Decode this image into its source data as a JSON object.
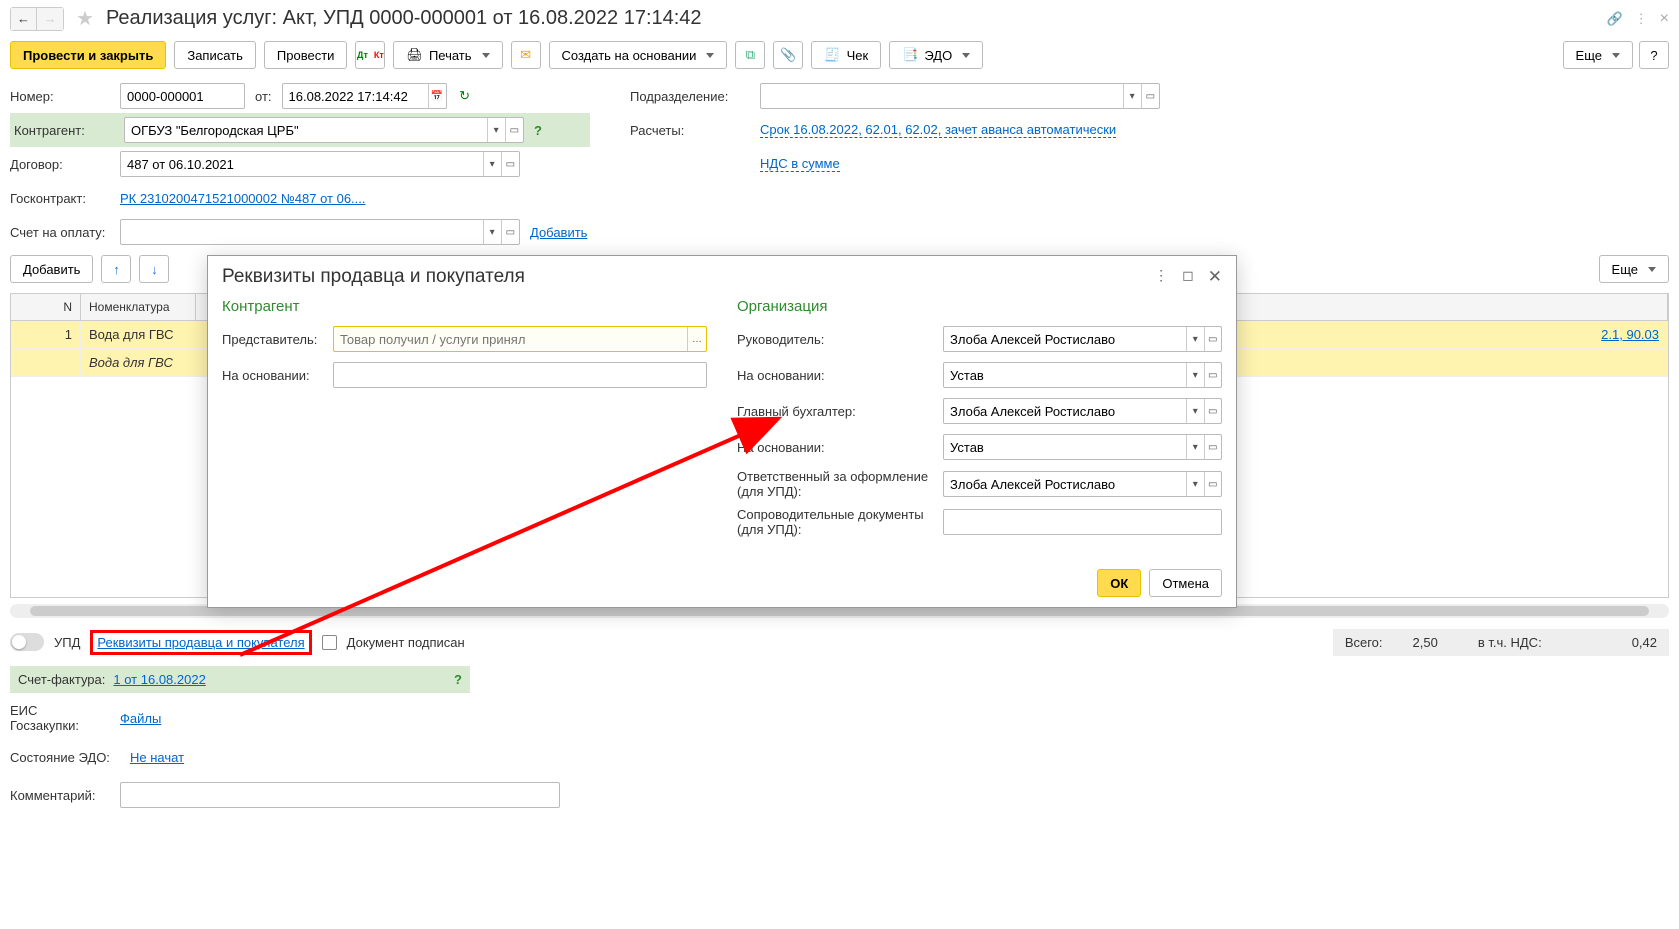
{
  "header": {
    "title": "Реализация услуг: Акт, УПД 0000-000001 от 16.08.2022 17:14:42"
  },
  "toolbar": {
    "post_close": "Провести и закрыть",
    "save": "Записать",
    "post": "Провести",
    "print": "Печать",
    "create_based": "Создать на основании",
    "check": "Чек",
    "edo": "ЭДО",
    "more": "Еще"
  },
  "form": {
    "number_label": "Номер:",
    "number": "0000-000001",
    "date_label": "от:",
    "date": "16.08.2022 17:14:42",
    "division_label": "Подразделение:",
    "counterparty_label": "Контрагент:",
    "counterparty": "ОГБУЗ \"Белгородская ЦРБ\"",
    "settlements_label": "Расчеты:",
    "settlements_link": "Срок 16.08.2022, 62.01, 62.02, зачет аванса автоматически",
    "contract_label": "Договор:",
    "contract": "487 от 06.10.2021",
    "vat_link": "НДС в сумме",
    "govcontract_label": "Госконтракт:",
    "govcontract_link": "РК 2310200471521000002 №487 от 06....",
    "invoice_label": "Счет на оплату:",
    "add_link": "Добавить"
  },
  "grid": {
    "add_btn": "Добавить",
    "more": "Еще",
    "head_n": "N",
    "head_nom": "Номенклатура",
    "rows": [
      {
        "n": "1",
        "nom": "Вода для ГВС"
      },
      {
        "n": "",
        "nom": "Вода для ГВС"
      }
    ],
    "account_link": "2.1, 90.03"
  },
  "footer": {
    "upd_label": "УПД",
    "details_link": "Реквизиты продавца и покупателя",
    "signed_label": "Документ подписан",
    "total_label": "Всего:",
    "total": "2,50",
    "vat_label": "в т.ч. НДС:",
    "vat": "0,42",
    "sf_label": "Счет-фактура:",
    "sf_link": "1 от 16.08.2022",
    "eis_label": "ЕИС Госзакупки:",
    "eis_link": "Файлы",
    "edo_state_label": "Состояние ЭДО:",
    "edo_state_link": "Не начат",
    "comment_label": "Комментарий:"
  },
  "modal": {
    "title": "Реквизиты продавца и покупателя",
    "section_counterparty": "Контрагент",
    "section_org": "Организация",
    "repr_label": "Представитель:",
    "repr_placeholder": "Товар получил / услуги принял",
    "basis_label": "На основании:",
    "head_label": "Руководитель:",
    "head_value": "Злоба Алексей Ростиславо",
    "basis_org_value": "Устав",
    "accountant_label": "Главный бухгалтер:",
    "accountant_value": "Злоба Алексей Ростиславо",
    "basis2_value": "Устав",
    "responsible_label": "Ответственный за оформление (для УПД):",
    "responsible_value": "Злоба Алексей Ростиславо",
    "docs_label": "Сопроводительные документы (для УПД):",
    "ok": "ОК",
    "cancel": "Отмена"
  }
}
